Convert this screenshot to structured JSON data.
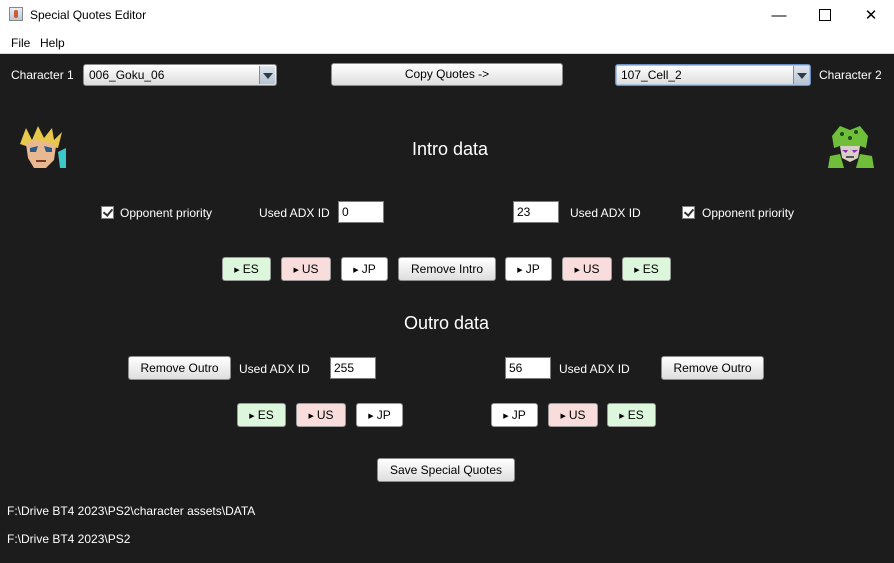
{
  "window": {
    "title": "Special Quotes Editor",
    "minimize": "—",
    "close": "✕"
  },
  "menu": {
    "file": "File",
    "help": "Help"
  },
  "top": {
    "char1_label": "Character 1",
    "char1_value": "006_Goku_06",
    "copy_button": "Copy Quotes ->",
    "char2_value": "107_Cell_2",
    "char2_label": "Character 2"
  },
  "intro": {
    "title": "Intro data",
    "opponent_priority": "Opponent priority",
    "used_adx_id": "Used ADX ID",
    "left_adx": "0",
    "right_adx": "23",
    "remove_button": "Remove Intro",
    "left_buttons": [
      "ES",
      "US",
      "JP"
    ],
    "right_buttons": [
      "JP",
      "US",
      "ES"
    ]
  },
  "outro": {
    "title": "Outro data",
    "remove_button": "Remove Outro",
    "used_adx_id": "Used ADX ID",
    "left_adx": "255",
    "right_adx": "56",
    "left_buttons": [
      "ES",
      "US",
      "JP"
    ],
    "right_buttons": [
      "JP",
      "US",
      "ES"
    ]
  },
  "save_button": "Save Special Quotes",
  "paths": {
    "data_path": "F:\\Drive BT4 2023\\PS2\\character assets\\DATA",
    "root_path": "F:\\Drive BT4 2023\\PS2"
  },
  "play_icon": "play-triangle-icon",
  "colors": {
    "es": "#dcf7dc",
    "us": "#f9dcdc",
    "jp": "#ffffff",
    "background": "#1c1c1c"
  }
}
